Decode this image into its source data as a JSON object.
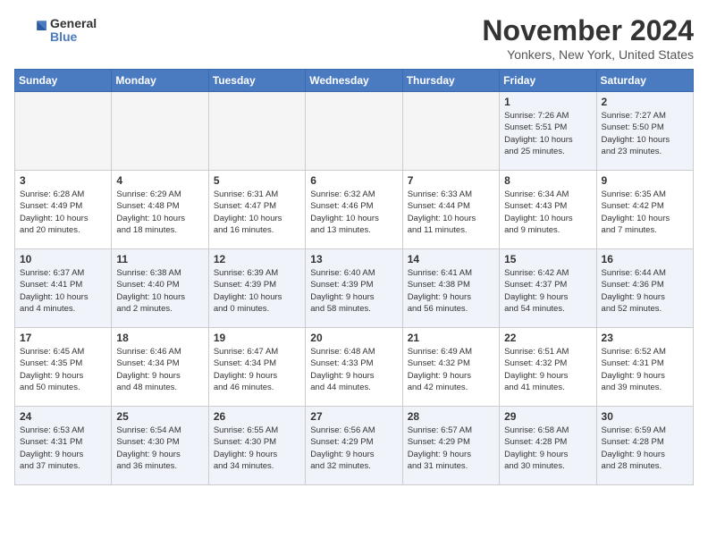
{
  "logo": {
    "general": "General",
    "blue": "Blue"
  },
  "title": "November 2024",
  "location": "Yonkers, New York, United States",
  "weekdays": [
    "Sunday",
    "Monday",
    "Tuesday",
    "Wednesday",
    "Thursday",
    "Friday",
    "Saturday"
  ],
  "weeks": [
    [
      {
        "day": "",
        "detail": ""
      },
      {
        "day": "",
        "detail": ""
      },
      {
        "day": "",
        "detail": ""
      },
      {
        "day": "",
        "detail": ""
      },
      {
        "day": "",
        "detail": ""
      },
      {
        "day": "1",
        "detail": "Sunrise: 7:26 AM\nSunset: 5:51 PM\nDaylight: 10 hours\nand 25 minutes."
      },
      {
        "day": "2",
        "detail": "Sunrise: 7:27 AM\nSunset: 5:50 PM\nDaylight: 10 hours\nand 23 minutes."
      }
    ],
    [
      {
        "day": "3",
        "detail": "Sunrise: 6:28 AM\nSunset: 4:49 PM\nDaylight: 10 hours\nand 20 minutes."
      },
      {
        "day": "4",
        "detail": "Sunrise: 6:29 AM\nSunset: 4:48 PM\nDaylight: 10 hours\nand 18 minutes."
      },
      {
        "day": "5",
        "detail": "Sunrise: 6:31 AM\nSunset: 4:47 PM\nDaylight: 10 hours\nand 16 minutes."
      },
      {
        "day": "6",
        "detail": "Sunrise: 6:32 AM\nSunset: 4:46 PM\nDaylight: 10 hours\nand 13 minutes."
      },
      {
        "day": "7",
        "detail": "Sunrise: 6:33 AM\nSunset: 4:44 PM\nDaylight: 10 hours\nand 11 minutes."
      },
      {
        "day": "8",
        "detail": "Sunrise: 6:34 AM\nSunset: 4:43 PM\nDaylight: 10 hours\nand 9 minutes."
      },
      {
        "day": "9",
        "detail": "Sunrise: 6:35 AM\nSunset: 4:42 PM\nDaylight: 10 hours\nand 7 minutes."
      }
    ],
    [
      {
        "day": "10",
        "detail": "Sunrise: 6:37 AM\nSunset: 4:41 PM\nDaylight: 10 hours\nand 4 minutes."
      },
      {
        "day": "11",
        "detail": "Sunrise: 6:38 AM\nSunset: 4:40 PM\nDaylight: 10 hours\nand 2 minutes."
      },
      {
        "day": "12",
        "detail": "Sunrise: 6:39 AM\nSunset: 4:39 PM\nDaylight: 10 hours\nand 0 minutes."
      },
      {
        "day": "13",
        "detail": "Sunrise: 6:40 AM\nSunset: 4:39 PM\nDaylight: 9 hours\nand 58 minutes."
      },
      {
        "day": "14",
        "detail": "Sunrise: 6:41 AM\nSunset: 4:38 PM\nDaylight: 9 hours\nand 56 minutes."
      },
      {
        "day": "15",
        "detail": "Sunrise: 6:42 AM\nSunset: 4:37 PM\nDaylight: 9 hours\nand 54 minutes."
      },
      {
        "day": "16",
        "detail": "Sunrise: 6:44 AM\nSunset: 4:36 PM\nDaylight: 9 hours\nand 52 minutes."
      }
    ],
    [
      {
        "day": "17",
        "detail": "Sunrise: 6:45 AM\nSunset: 4:35 PM\nDaylight: 9 hours\nand 50 minutes."
      },
      {
        "day": "18",
        "detail": "Sunrise: 6:46 AM\nSunset: 4:34 PM\nDaylight: 9 hours\nand 48 minutes."
      },
      {
        "day": "19",
        "detail": "Sunrise: 6:47 AM\nSunset: 4:34 PM\nDaylight: 9 hours\nand 46 minutes."
      },
      {
        "day": "20",
        "detail": "Sunrise: 6:48 AM\nSunset: 4:33 PM\nDaylight: 9 hours\nand 44 minutes."
      },
      {
        "day": "21",
        "detail": "Sunrise: 6:49 AM\nSunset: 4:32 PM\nDaylight: 9 hours\nand 42 minutes."
      },
      {
        "day": "22",
        "detail": "Sunrise: 6:51 AM\nSunset: 4:32 PM\nDaylight: 9 hours\nand 41 minutes."
      },
      {
        "day": "23",
        "detail": "Sunrise: 6:52 AM\nSunset: 4:31 PM\nDaylight: 9 hours\nand 39 minutes."
      }
    ],
    [
      {
        "day": "24",
        "detail": "Sunrise: 6:53 AM\nSunset: 4:31 PM\nDaylight: 9 hours\nand 37 minutes."
      },
      {
        "day": "25",
        "detail": "Sunrise: 6:54 AM\nSunset: 4:30 PM\nDaylight: 9 hours\nand 36 minutes."
      },
      {
        "day": "26",
        "detail": "Sunrise: 6:55 AM\nSunset: 4:30 PM\nDaylight: 9 hours\nand 34 minutes."
      },
      {
        "day": "27",
        "detail": "Sunrise: 6:56 AM\nSunset: 4:29 PM\nDaylight: 9 hours\nand 32 minutes."
      },
      {
        "day": "28",
        "detail": "Sunrise: 6:57 AM\nSunset: 4:29 PM\nDaylight: 9 hours\nand 31 minutes."
      },
      {
        "day": "29",
        "detail": "Sunrise: 6:58 AM\nSunset: 4:28 PM\nDaylight: 9 hours\nand 30 minutes."
      },
      {
        "day": "30",
        "detail": "Sunrise: 6:59 AM\nSunset: 4:28 PM\nDaylight: 9 hours\nand 28 minutes."
      }
    ]
  ]
}
